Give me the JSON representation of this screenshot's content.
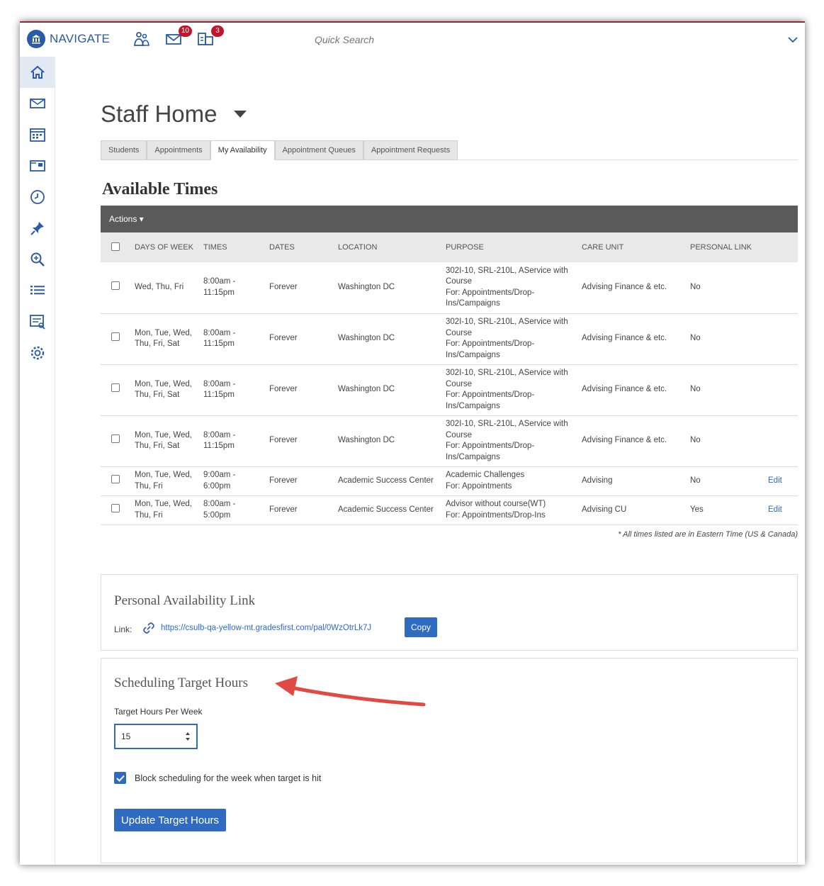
{
  "app": {
    "brand": "NAVIGATE",
    "mail_badge": "10",
    "alerts_badge": "3",
    "search_placeholder": "Quick Search"
  },
  "colors": {
    "accent": "#2f6cc1",
    "badge": "#c0152a",
    "actions_bar": "#5a5a5a"
  },
  "sidebar": {
    "items": [
      {
        "icon": "home-icon",
        "active": true
      },
      {
        "icon": "mail-icon"
      },
      {
        "icon": "calendar-icon"
      },
      {
        "icon": "card-icon"
      },
      {
        "icon": "history-icon"
      },
      {
        "icon": "pin-icon"
      },
      {
        "icon": "search-zoom-icon"
      },
      {
        "icon": "list-icon"
      },
      {
        "icon": "report-icon"
      },
      {
        "icon": "settings-icon"
      }
    ]
  },
  "page": {
    "title": "Staff Home",
    "tabs": [
      "Students",
      "Appointments",
      "My Availability",
      "Appointment Queues",
      "Appointment Requests"
    ],
    "active_tab": "My Availability"
  },
  "available_times": {
    "title": "Available Times",
    "actions_label": "Actions ▾",
    "columns": [
      "DAYS OF WEEK",
      "TIMES",
      "DATES",
      "LOCATION",
      "PURPOSE",
      "CARE UNIT",
      "PERSONAL LINK"
    ],
    "rows": [
      {
        "days": "Wed, Thu, Fri",
        "times": "8:00am - 11:15pm",
        "dates": "Forever",
        "location": "Washington DC",
        "purpose_1": "302I-10, SRL-210L, AService with Course",
        "purpose_2": "For: Appointments/Drop-Ins/Campaigns",
        "care_unit": "Advising Finance & etc.",
        "personal_link": "No",
        "edit": ""
      },
      {
        "days": "Mon, Tue, Wed, Thu, Fri, Sat",
        "times": "8:00am - 11:15pm",
        "dates": "Forever",
        "location": "Washington DC",
        "purpose_1": "302I-10, SRL-210L, AService with Course",
        "purpose_2": "For: Appointments/Drop-Ins/Campaigns",
        "care_unit": "Advising Finance & etc.",
        "personal_link": "No",
        "edit": ""
      },
      {
        "days": "Mon, Tue, Wed, Thu, Fri, Sat",
        "times": "8:00am - 11:15pm",
        "dates": "Forever",
        "location": "Washington DC",
        "purpose_1": "302I-10, SRL-210L, AService with Course",
        "purpose_2": "For: Appointments/Drop-Ins/Campaigns",
        "care_unit": "Advising Finance & etc.",
        "personal_link": "No",
        "edit": ""
      },
      {
        "days": "Mon, Tue, Wed, Thu, Fri, Sat",
        "times": "8:00am - 11:15pm",
        "dates": "Forever",
        "location": "Washington DC",
        "purpose_1": "302I-10, SRL-210L, AService with Course",
        "purpose_2": "For: Appointments/Drop-Ins/Campaigns",
        "care_unit": "Advising Finance & etc.",
        "personal_link": "No",
        "edit": ""
      },
      {
        "days": "Mon, Tue, Wed, Thu, Fri",
        "times": "9:00am - 6:00pm",
        "dates": "Forever",
        "location": "Academic Success Center",
        "purpose_1": "Academic Challenges",
        "purpose_2": "For: Appointments",
        "care_unit": "Advising",
        "personal_link": "No",
        "edit": "Edit"
      },
      {
        "days": "Mon, Tue, Wed, Thu, Fri",
        "times": "8:00am - 5:00pm",
        "dates": "Forever",
        "location": "Academic Success Center",
        "purpose_1": "Advisor without course(WT)",
        "purpose_2": "For: Appointments/Drop-Ins",
        "care_unit": "Advising CU",
        "personal_link": "Yes",
        "edit": "Edit"
      }
    ],
    "tz_note": "* All times listed are in Eastern Time (US & Canada)"
  },
  "personal_link": {
    "title": "Personal Availability Link",
    "label": "Link:",
    "url": "https://csulb-qa-yellow-mt.gradesfirst.com/pal/0WzOtrLk7J",
    "copy_label": "Copy"
  },
  "target_hours": {
    "title": "Scheduling Target Hours",
    "field_label": "Target Hours Per Week",
    "value": "15",
    "block_label": "Block scheduling for the week when target is hit",
    "block_checked": true,
    "button_label": "Update Target Hours"
  }
}
